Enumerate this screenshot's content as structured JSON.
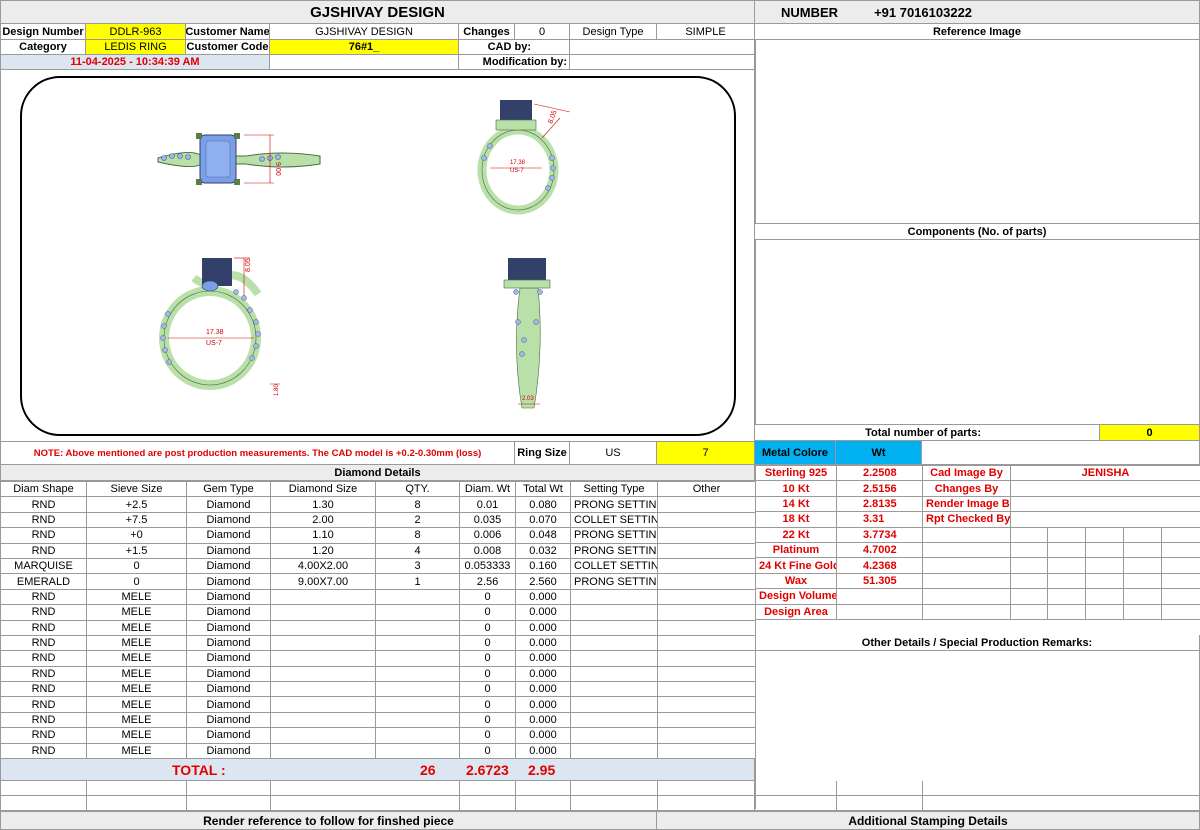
{
  "header": {
    "company": "GJSHIVAY DESIGN",
    "number_label": "NUMBER",
    "number_value": "+91 7016103222"
  },
  "info": {
    "design_number_label": "Design Number",
    "design_number": "DDLR-963",
    "customer_name_label": "Customer Name",
    "customer_name": "GJSHIVAY DESIGN",
    "changes_label": "Changes",
    "changes": "0",
    "design_type_label": "Design Type",
    "design_type": "SIMPLE",
    "category_label": "Category",
    "category": "LEDIS RING",
    "customer_code_label": "Customer Code",
    "customer_code": "76#1_",
    "cad_by_label": "CAD by:",
    "cad_by": "",
    "timestamp": "11-04-2025 - 10:34:39 AM",
    "modification_label": "Modification by:",
    "modification": ""
  },
  "reference_image_label": "Reference Image",
  "components_label": "Components (No. of parts)",
  "total_parts_label": "Total number of parts:",
  "total_parts": "0",
  "render": {
    "dim_height_front": "9.00",
    "dim_top_side": "8.05",
    "dim_inner_side": "17.38",
    "dim_us_side": "US-7",
    "dim_side2_height": "8.05",
    "dim_inner_front2": "17.38",
    "dim_us_front2": "US-7",
    "dim_band": "1.80",
    "dim_band2": "2.03",
    "dim_band3": "1.80"
  },
  "note": "NOTE: Above mentioned are post production measurements. The CAD model is +0.2-0.30mm (loss)",
  "ring_size_label": "Ring Size",
  "ring_size_system": "US",
  "ring_size": "7",
  "metal": {
    "color_label": "Metal Colore",
    "wt_label": "Wt",
    "rows": [
      {
        "name": "Sterling 925",
        "wt": "2.2508"
      },
      {
        "name": "10 Kt",
        "wt": "2.5156"
      },
      {
        "name": "14 Kt",
        "wt": "2.8135"
      },
      {
        "name": "18 Kt",
        "wt": "3.31"
      },
      {
        "name": "22 Kt",
        "wt": "3.7734"
      },
      {
        "name": "Platinum",
        "wt": "4.7002"
      },
      {
        "name": "24 Kt Fine Gold",
        "wt": "4.2368"
      },
      {
        "name": "Wax",
        "wt": "51.305"
      },
      {
        "name": "Design Volume",
        "wt": ""
      },
      {
        "name": "Design Area",
        "wt": ""
      }
    ],
    "credits": [
      {
        "label": "Cad Image By",
        "value": "JENISHA"
      },
      {
        "label": "Changes By",
        "value": ""
      },
      {
        "label": "Render Image By",
        "value": ""
      },
      {
        "label": "Rpt Checked By",
        "value": ""
      }
    ]
  },
  "other_details_label": "Other Details / Special Production Remarks:",
  "diamond": {
    "title": "Diamond Details",
    "headers": [
      "Diam Shape",
      "Sieve Size",
      "Gem Type",
      "Diamond Size",
      "QTY.",
      "Diam. Wt",
      "Total Wt",
      "Setting Type",
      "Other"
    ],
    "rows": [
      [
        "RND",
        "+2.5",
        "Diamond",
        "1.30",
        "8",
        "0.01",
        "0.080",
        "PRONG SETTING",
        ""
      ],
      [
        "RND",
        "+7.5",
        "Diamond",
        "2.00",
        "2",
        "0.035",
        "0.070",
        "COLLET SETTING",
        ""
      ],
      [
        "RND",
        "+0",
        "Diamond",
        "1.10",
        "8",
        "0.006",
        "0.048",
        "PRONG SETTING",
        ""
      ],
      [
        "RND",
        "+1.5",
        "Diamond",
        "1.20",
        "4",
        "0.008",
        "0.032",
        "PRONG SETTING",
        ""
      ],
      [
        "MARQUISE",
        "0",
        "Diamond",
        "4.00X2.00",
        "3",
        "0.053333",
        "0.160",
        "COLLET SETTING",
        ""
      ],
      [
        "EMERALD",
        "0",
        "Diamond",
        "9.00X7.00",
        "1",
        "2.56",
        "2.560",
        "PRONG SETTING",
        ""
      ],
      [
        "RND",
        "MELE",
        "Diamond",
        "",
        "",
        "0",
        "0.000",
        "",
        ""
      ],
      [
        "RND",
        "MELE",
        "Diamond",
        "",
        "",
        "0",
        "0.000",
        "",
        ""
      ],
      [
        "RND",
        "MELE",
        "Diamond",
        "",
        "",
        "0",
        "0.000",
        "",
        ""
      ],
      [
        "RND",
        "MELE",
        "Diamond",
        "",
        "",
        "0",
        "0.000",
        "",
        ""
      ],
      [
        "RND",
        "MELE",
        "Diamond",
        "",
        "",
        "0",
        "0.000",
        "",
        ""
      ],
      [
        "RND",
        "MELE",
        "Diamond",
        "",
        "",
        "0",
        "0.000",
        "",
        ""
      ],
      [
        "RND",
        "MELE",
        "Diamond",
        "",
        "",
        "0",
        "0.000",
        "",
        ""
      ],
      [
        "RND",
        "MELE",
        "Diamond",
        "",
        "",
        "0",
        "0.000",
        "",
        ""
      ],
      [
        "RND",
        "MELE",
        "Diamond",
        "",
        "",
        "0",
        "0.000",
        "",
        ""
      ],
      [
        "RND",
        "MELE",
        "Diamond",
        "",
        "",
        "0",
        "0.000",
        "",
        ""
      ],
      [
        "RND",
        "MELE",
        "Diamond",
        "",
        "",
        "0",
        "0.000",
        "",
        ""
      ]
    ],
    "total_label": "TOTAL :",
    "total_qty": "26",
    "total_diam_wt": "2.6723",
    "total_wt": "2.95"
  },
  "footer": {
    "render_note": "Render reference to follow for finshed piece",
    "stamping": "Additional Stamping Details"
  },
  "colors": {
    "yellow": "#ffff00",
    "light_blue": "#dce6f1",
    "blue": "#00b0f0",
    "red": "#e00000",
    "metal_green": "#b8e0a8",
    "gem_blue": "#7a9ee8"
  }
}
